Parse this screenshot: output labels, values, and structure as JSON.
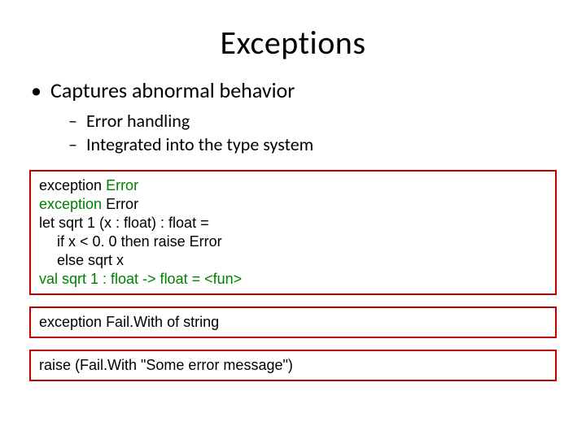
{
  "title": "Exceptions",
  "bullets": {
    "l1": "Captures abnormal behavior",
    "l2a": "Error handling",
    "l2b": "Integrated into the type system"
  },
  "code1": {
    "line1_kw": "exception",
    "line1_id": " Error",
    "line2_kw": "exception",
    "line2_id": " Error",
    "line3_a": "let ",
    "line3_b": "sqrt 1 (x : float) : float =",
    "line4_a": "if ",
    "line4_b": "x < 0. 0 ",
    "line4_c": "then raise ",
    "line4_d": "Error",
    "line5_a": "else ",
    "line5_b": "sqrt x",
    "line6": "val sqrt 1 : float -> float = <fun>"
  },
  "code2": {
    "line1_a": "exception ",
    "line1_b": "Fail.With ",
    "line1_c": "of ",
    "line1_d": "string"
  },
  "code3": {
    "line1_a": "raise ",
    "line1_b": "(Fail.With \"Some error message\")"
  }
}
